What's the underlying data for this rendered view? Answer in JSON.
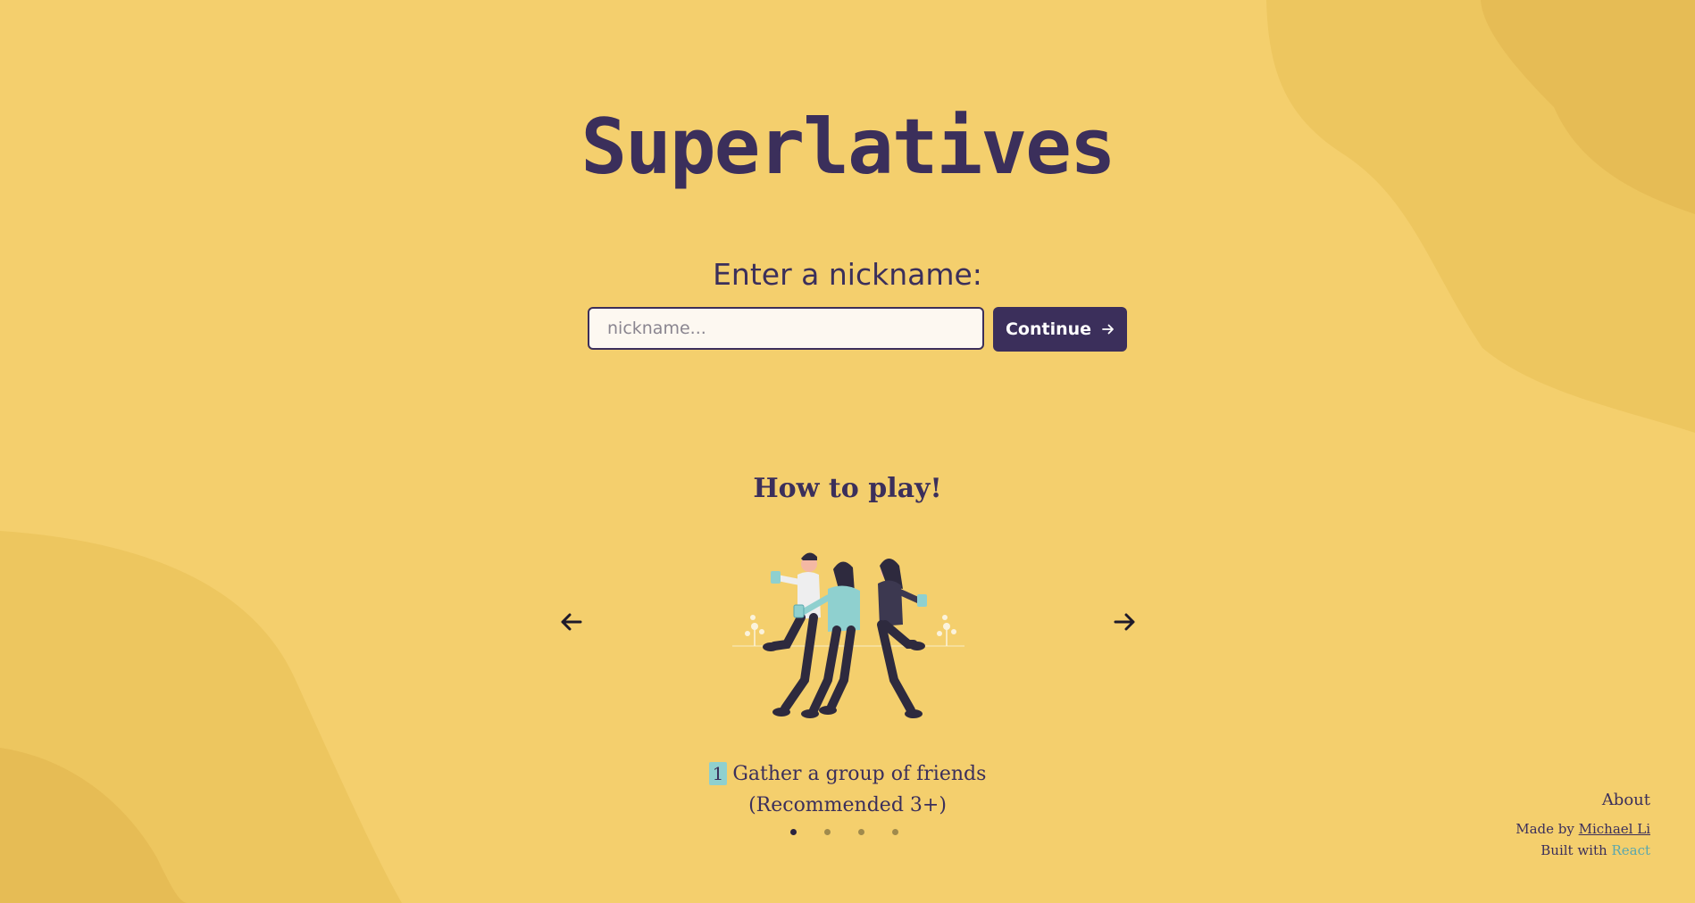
{
  "app": {
    "title": "Superlatives"
  },
  "nickname_form": {
    "prompt": "Enter a nickname:",
    "placeholder": "nickname...",
    "value": "",
    "continue_label": "Continue",
    "continue_icon": "arrow-right-icon"
  },
  "how_to_play": {
    "heading": "How to play!",
    "current_step": {
      "number": "1",
      "text_line1": "Gather a group of friends",
      "text_line2": "(Recommended 3+)"
    },
    "total_steps": 4,
    "active_index": 0,
    "prev_icon": "arrow-left-icon",
    "next_icon": "arrow-right-icon"
  },
  "footer": {
    "about": "About",
    "made_by_prefix": "Made by",
    "author": "Michael Li",
    "built_with_prefix": "Built with",
    "tech": "React"
  },
  "colors": {
    "background": "#f4cf6d",
    "blob": "#eac25f",
    "accent": "#3b2f5b",
    "highlight": "#8fd0cf",
    "link": "#5aa7ae"
  }
}
